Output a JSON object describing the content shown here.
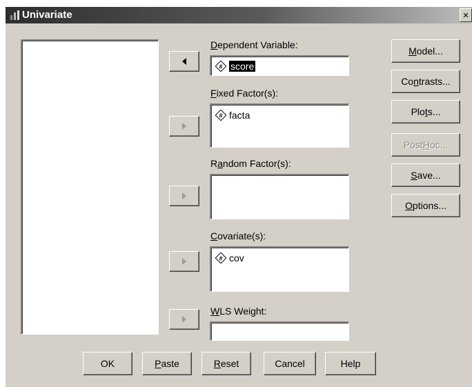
{
  "window": {
    "title": "Univariate",
    "close_label": "×"
  },
  "labels": {
    "dependent_prefix": "",
    "dependent_u": "D",
    "dependent_rest": "ependent Variable:",
    "fixed_u": "F",
    "fixed_rest": "ixed Factor(s):",
    "random_pre": "R",
    "random_u": "a",
    "random_rest": "ndom Factor(s):",
    "covariate_u": "C",
    "covariate_rest": "ovariate(s):",
    "wls_u": "W",
    "wls_rest": "LS Weight:"
  },
  "fields": {
    "dependent": {
      "value": "score",
      "selected": true,
      "icon": "scale-variable-icon"
    },
    "fixed_factors": [
      {
        "value": "facta",
        "icon": "scale-variable-icon"
      }
    ],
    "random_factors": [],
    "covariates": [
      {
        "value": "cov",
        "icon": "scale-variable-icon"
      }
    ],
    "wls_weight": ""
  },
  "side_buttons": {
    "model": {
      "u": "M",
      "rest": "odel..."
    },
    "contrasts": {
      "pre": "Co",
      "u": "n",
      "rest": "trasts..."
    },
    "plots": {
      "pre": "Plo",
      "u": "t",
      "rest": "s..."
    },
    "post_hoc": {
      "pre": "Post ",
      "u": "H",
      "rest": "oc...",
      "disabled": true
    },
    "save": {
      "u": "S",
      "rest": "ave..."
    },
    "options": {
      "u": "O",
      "rest": "ptions..."
    }
  },
  "bottom_buttons": {
    "ok": {
      "label": "OK"
    },
    "paste": {
      "u": "P",
      "rest": "aste"
    },
    "reset": {
      "u": "R",
      "rest": "eset"
    },
    "cancel": {
      "label": "Cancel"
    },
    "help": {
      "label": "Help"
    }
  },
  "colors": {
    "face": "#d4d0c8",
    "title_dark": "#2e2e2e",
    "title_light": "#bdbdbd"
  }
}
